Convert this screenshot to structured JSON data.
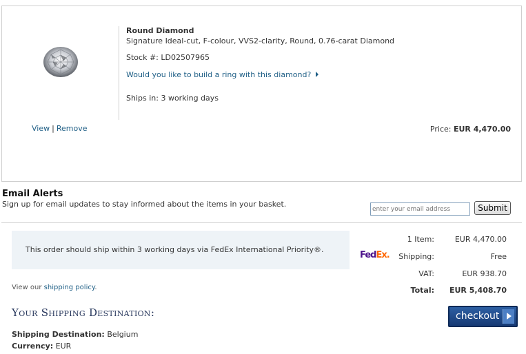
{
  "item": {
    "title": "Round Diamond",
    "description": "Signature Ideal-cut, F-colour, VVS2-clarity, Round, 0.76-carat Diamond",
    "stock_label": "Stock #:",
    "stock_number": "LD02507965",
    "build_ring_link": "Would you like to build a ring with this diamond?",
    "ships_in": "Ships in: 3 working days",
    "view_link": "View",
    "separator": "|",
    "remove_link": "Remove",
    "price_label": "Price:",
    "price_value": "EUR 4,470.00"
  },
  "email_alerts": {
    "title": "Email Alerts",
    "subtitle": "Sign up for email updates to stay informed about the items in your basket.",
    "input_placeholder": "enter your email address",
    "submit_label": "Submit"
  },
  "shipping": {
    "notice": "This order should ship within 3 working days via FedEx International Priority®.",
    "policy_prefix": "View our",
    "policy_link": "shipping policy",
    "policy_suffix": ".",
    "carrier_logo_left": "Fed",
    "carrier_logo_right": "Ex."
  },
  "summary": {
    "items_label": "1 Item:",
    "items_value": "EUR 4,470.00",
    "shipping_label": "Shipping:",
    "shipping_value": "Free",
    "vat_label": "VAT:",
    "vat_value": "EUR 938.70",
    "total_label": "Total:",
    "total_value": "EUR 5,408.70"
  },
  "destination": {
    "heading": "Your Shipping Destination:",
    "dest_label": "Shipping Destination:",
    "dest_value": "Belgium",
    "currency_label": "Currency:",
    "currency_value": "EUR"
  },
  "checkout": {
    "label": "checkout"
  },
  "colors": {
    "link": "#1f5f86",
    "checkout_bg": "#1e4a8c",
    "shipping_box_bg": "#eef3f7",
    "heading_navy": "#24345a"
  }
}
